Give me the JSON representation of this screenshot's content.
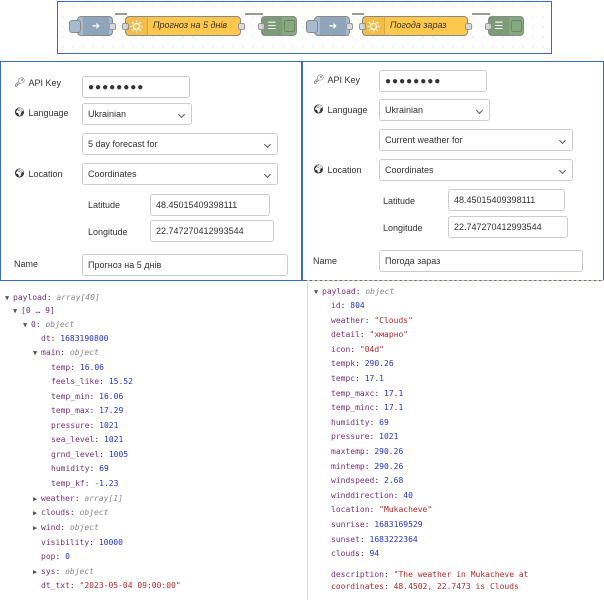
{
  "flow": {
    "node1_label": "Прогноз на 5 днів",
    "node2_label": "Погода зараз"
  },
  "left_panel": {
    "api_key_label": "API Key",
    "api_key_value": "●●●●●●●●",
    "language_label": "Language",
    "language_value": "Ukrainian",
    "mode_value": "5 day forecast for",
    "location_label": "Location",
    "location_value": "Coordinates",
    "latitude_label": "Latitude",
    "latitude_value": "48.45015409398111",
    "longitude_label": "Longitude",
    "longitude_value": "22.747270412993544",
    "name_label": "Name",
    "name_value": "Прогноз на 5 днів"
  },
  "right_panel": {
    "api_key_label": "API Key",
    "api_key_value": "●●●●●●●●",
    "language_label": "Language",
    "language_value": "Ukrainian",
    "mode_value": "Current weather for",
    "location_label": "Location",
    "location_value": "Coordinates",
    "latitude_label": "Latitude",
    "latitude_value": "48.45015409398111",
    "longitude_label": "Longitude",
    "longitude_value": "22.747270412993544",
    "name_label": "Name",
    "name_value": "Погода зараз"
  },
  "debug_left": {
    "payload_key": "payload",
    "payload_type": "array[40]",
    "range": "[0 … 9]",
    "item0_key": "0",
    "item0_type": "object",
    "dt_key": "dt",
    "dt_val": "1683190800",
    "main_key": "main",
    "main_type": "object",
    "main_rows": [
      {
        "k": "temp",
        "v": "16.06"
      },
      {
        "k": "feels_like",
        "v": "15.52"
      },
      {
        "k": "temp_min",
        "v": "16.06"
      },
      {
        "k": "temp_max",
        "v": "17.29"
      },
      {
        "k": "pressure",
        "v": "1021"
      },
      {
        "k": "sea_level",
        "v": "1021"
      },
      {
        "k": "grnd_level",
        "v": "1005"
      },
      {
        "k": "humidity",
        "v": "69"
      },
      {
        "k": "temp_kf",
        "v": "-1.23"
      }
    ],
    "weather_key": "weather",
    "weather_type": "array[1]",
    "clouds_key": "clouds",
    "clouds_type": "object",
    "wind_key": "wind",
    "wind_type": "object",
    "visibility_key": "visibility",
    "visibility_val": "10000",
    "pop_key": "pop",
    "pop_val": "0",
    "sys_key": "sys",
    "sys_type": "object",
    "dt_txt_key": "dt_txt",
    "dt_txt_val": "\"2023-05-04 09:00:00\""
  },
  "debug_right": {
    "payload_key": "payload",
    "payload_type": "object",
    "rows": [
      {
        "k": "id",
        "v": "804",
        "c": "n"
      },
      {
        "k": "weather",
        "v": "\"Clouds\"",
        "c": "s"
      },
      {
        "k": "detail",
        "v": "\"хмарно\"",
        "c": "s"
      },
      {
        "k": "icon",
        "v": "\"04d\"",
        "c": "s"
      },
      {
        "k": "tempk",
        "v": "290.26",
        "c": "n"
      },
      {
        "k": "tempc",
        "v": "17.1",
        "c": "n"
      },
      {
        "k": "temp_maxc",
        "v": "17.1",
        "c": "n"
      },
      {
        "k": "temp_minc",
        "v": "17.1",
        "c": "n"
      },
      {
        "k": "humidity",
        "v": "69",
        "c": "n"
      },
      {
        "k": "pressure",
        "v": "1021",
        "c": "n"
      },
      {
        "k": "maxtemp",
        "v": "290.26",
        "c": "n"
      },
      {
        "k": "mintemp",
        "v": "290.26",
        "c": "n"
      },
      {
        "k": "windspeed",
        "v": "2.68",
        "c": "n"
      },
      {
        "k": "winddirection",
        "v": "40",
        "c": "n"
      },
      {
        "k": "location",
        "v": "\"Mukacheve\"",
        "c": "s"
      },
      {
        "k": "sunrise",
        "v": "1683169529",
        "c": "n"
      },
      {
        "k": "sunset",
        "v": "1683222364",
        "c": "n"
      },
      {
        "k": "clouds",
        "v": "94",
        "c": "n"
      }
    ],
    "description_key": "description",
    "description_line1": "\"The weather in Mukacheve at",
    "description_line2": "coordinates: 48.4502, 22.7473 is Clouds"
  }
}
